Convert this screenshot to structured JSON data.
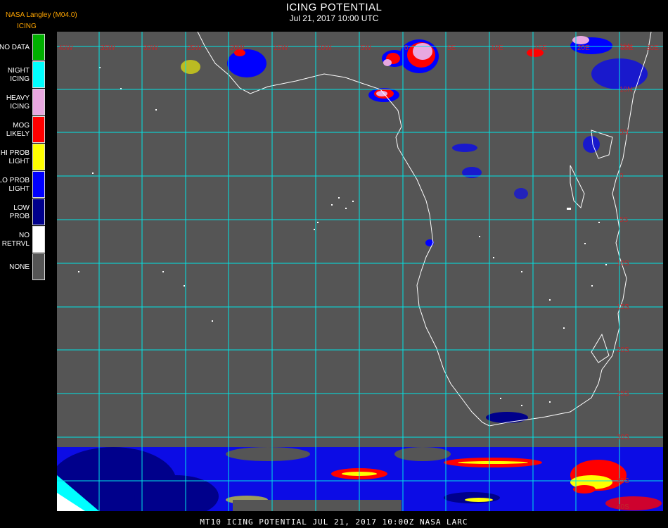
{
  "header": {
    "credit": "NASA Langley (M04.0)",
    "product": "ICING",
    "title": "ICING POTENTIAL",
    "subtitle": "Jul 21, 2017 10:00 UTC"
  },
  "legend": [
    {
      "label": "NO DATA",
      "color": "#00b000"
    },
    {
      "label": "NIGHT\nICING",
      "color": "#00ffff"
    },
    {
      "label": "HEAVY\nICING",
      "color": "#e8a8e0"
    },
    {
      "label": "MOG\nLIKELY",
      "color": "#ff0000"
    },
    {
      "label": "HI PROB\nLIGHT",
      "color": "#ffff00"
    },
    {
      "label": "LO PROB\nLIGHT",
      "color": "#0000ff"
    },
    {
      "label": "LOW\nPROB",
      "color": "#00008b"
    },
    {
      "label": "NO\nRETRVL",
      "color": "#ffffff"
    },
    {
      "label": "NONE",
      "color": "#555555"
    }
  ],
  "map": {
    "background": "#555555",
    "grid_color": "#00e5e5",
    "coast_color": "#ffffff",
    "lon_labels": [
      "40W",
      "35W",
      "30W",
      "25W",
      "20W",
      "15W",
      "10W",
      "5W",
      "0",
      "5E",
      "10E",
      "15E",
      "20E",
      "25E",
      "30E"
    ],
    "lat_labels": [
      "15N",
      "10N",
      "5N",
      "0",
      "5S",
      "10S",
      "15S",
      "20S",
      "25S",
      "30S",
      "35S",
      "40S",
      "45S"
    ]
  },
  "footer": "MT10  ICING POTENTIAL   JUL 21, 2017 10:00Z   NASA LARC"
}
